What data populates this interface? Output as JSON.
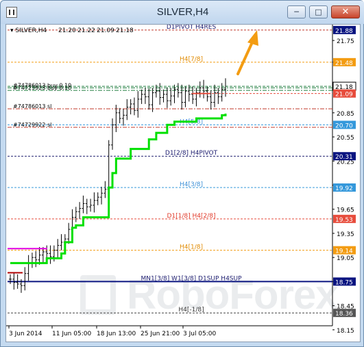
{
  "window": {
    "title": "SILVER,H4"
  },
  "watermark": {
    "brand": "RoboForex"
  },
  "chart_data": {
    "type": "candlestick",
    "symbol": "SILVER,H4",
    "header": {
      "symbol_label": "SILVER,H4",
      "open": "21.20",
      "high": "21.22",
      "low": "21.09",
      "close": "21.18"
    },
    "ylim": [
      18.2,
      21.93
    ],
    "y_ticks": [
      "21.75",
      "21.48",
      "21.18",
      "20.85",
      "20.55",
      "20.25",
      "19.95",
      "19.65",
      "19.35",
      "19.05",
      "18.75",
      "18.45",
      "18.15"
    ],
    "x_ticks": [
      "3 Jun 2014",
      "11 Jun 05:00",
      "18 Jun 13:00",
      "25 Jun 21:00",
      "3 Jul 05:00"
    ],
    "levels": [
      {
        "label": "D1PIVOT H4RES",
        "price": "21.88",
        "value": 21.88,
        "color": "#c0392b",
        "style": "dash",
        "text_color": "#1b1b6e",
        "badge_color": "#0a1480"
      },
      {
        "label": "H4[7/8]",
        "price": "21.48",
        "value": 21.48,
        "color": "#f39c12",
        "style": "dash",
        "text_color": "#e08a00",
        "badge_color": "#f39c12"
      },
      {
        "label": "H4[5/8]",
        "price": "20.70",
        "value": 20.7,
        "color": "#3498db",
        "style": "dash",
        "text_color": "#3b8fd6",
        "badge_color": "#3498db"
      },
      {
        "label": "D1[2/8] H4PIVOT",
        "price": "20.31",
        "value": 20.31,
        "color": "#1b1b6e",
        "style": "dash",
        "text_color": "#1b1b6e",
        "badge_color": "#0a1480"
      },
      {
        "label": "H4[3/8]",
        "price": "19.92",
        "value": 19.92,
        "color": "#3498db",
        "style": "dash",
        "text_color": "#3b8fd6",
        "badge_color": "#3498db"
      },
      {
        "label": "D1[1/8] H4[2/8]",
        "price": "19.53",
        "value": 19.53,
        "color": "#e74c3c",
        "style": "dash",
        "text_color": "#e03a2a",
        "badge_color": "#e74c3c"
      },
      {
        "label": "H4[1/8]",
        "price": "19.14",
        "value": 19.14,
        "color": "#f39c12",
        "style": "dash",
        "text_color": "#e08a00",
        "badge_color": "#f39c12"
      },
      {
        "label": "MN1[3/8] W1[3/8] D1SUP H4SUP",
        "price": "18.75",
        "value": 18.75,
        "color": "#0a1480",
        "style": "solid",
        "text_color": "#1b1b6e",
        "badge_color": "#0a1480"
      },
      {
        "label": "H4[-1/8]",
        "price": "18.36",
        "value": 18.36,
        "color": "#444444",
        "style": "dash",
        "text_color": "#333333",
        "badge_color": "#555555"
      }
    ],
    "current_price": {
      "value": 21.18,
      "label": "21.18"
    },
    "red_marker_price": {
      "value": 21.09,
      "label": "21.09"
    },
    "orders": [
      {
        "label": "#74729923 buy 0.10",
        "value": 21.13,
        "color": "#1a7a3a"
      },
      {
        "label": "#74786013 buy 0.10",
        "value": 21.16,
        "color": "#1a7a3a"
      },
      {
        "label": "#74786013 sl",
        "value": 20.9,
        "color": "#c0392b"
      },
      {
        "label": "#74729922 sl",
        "value": 20.67,
        "color": "#c0392b"
      }
    ],
    "closes": [
      18.78,
      18.74,
      18.72,
      18.7,
      18.85,
      18.98,
      19.05,
      19.02,
      19.08,
      19.12,
      19.1,
      19.06,
      19.14,
      19.2,
      19.24,
      19.28,
      19.4,
      19.55,
      19.62,
      19.66,
      19.72,
      19.68,
      19.7,
      19.76,
      19.8,
      19.85,
      19.9,
      20.45,
      20.7,
      20.85,
      20.78,
      20.82,
      20.92,
      20.96,
      20.88,
      21.02,
      21.08,
      21.05,
      20.95,
      21.1,
      21.12,
      21.04,
      21.08,
      21.0,
      21.06,
      21.14,
      21.1,
      20.98,
      21.12,
      21.08,
      21.02,
      21.1,
      21.16,
      21.12,
      21.05,
      20.98,
      21.1,
      21.05,
      21.14,
      21.18
    ],
    "stop_line": [
      18.98,
      18.98,
      18.98,
      18.98,
      18.98,
      18.98,
      18.98,
      18.98,
      18.98,
      18.98,
      19.04,
      19.04,
      19.04,
      19.04,
      19.1,
      19.24,
      19.24,
      19.42,
      19.45,
      19.45,
      19.55,
      19.55,
      19.55,
      19.55,
      19.55,
      19.55,
      19.55,
      19.92,
      20.1,
      20.28,
      20.28,
      20.28,
      20.28,
      20.4,
      20.4,
      20.4,
      20.4,
      20.4,
      20.52,
      20.52,
      20.6,
      20.6,
      20.6,
      20.7,
      20.7,
      20.74,
      20.74,
      20.74,
      20.74,
      20.74,
      20.74,
      20.78,
      20.78,
      20.78,
      20.78,
      20.78,
      20.78,
      20.78,
      20.82,
      20.84
    ],
    "arrow": {
      "direction": "up",
      "color": "#f39c12"
    }
  }
}
